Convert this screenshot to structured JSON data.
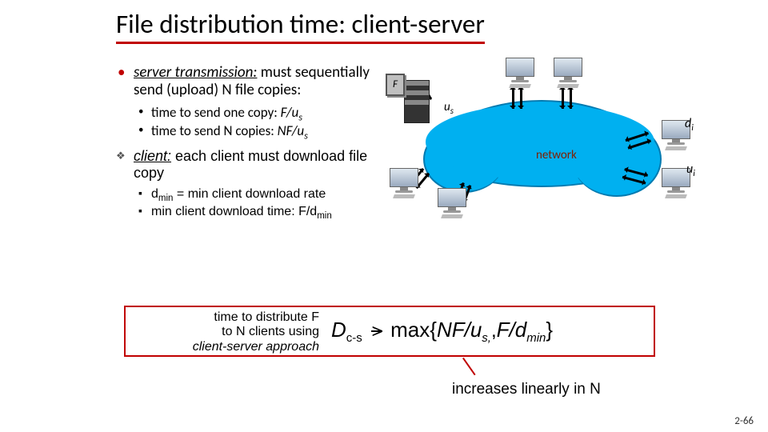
{
  "title": "File distribution time: client-server",
  "server_tx": {
    "heading_ital": "server transmission:",
    "heading_rest": " must sequentially send (upload) N file copies:",
    "sub1_a": "time to send one copy: ",
    "sub1_b": "F/u",
    "sub1_s": "s",
    "sub2_a": "time to send N copies: ",
    "sub2_b": "NF/u",
    "sub2_s": "s"
  },
  "client": {
    "heading_ital": "client:",
    "heading_rest": " each client must download file copy",
    "sub1_a": "d",
    "sub1_s": "min",
    "sub1_b": " = min client download rate",
    "sub2_a": "min client download time: F/d",
    "sub2_s": "min"
  },
  "diagram": {
    "F": "F",
    "us": "u",
    "us_s": "s",
    "di": "d",
    "di_s": "i",
    "ui": "u",
    "ui_s": "i",
    "network": "network"
  },
  "box": {
    "left1": "time to  distribute F",
    "left2": "to N clients using",
    "left3": "client-server approach",
    "D": "D",
    "D_sub": "c-s",
    "ge": ">",
    "max": "max{",
    "t1a": "NF/u",
    "t1s": "s,",
    "comma": ",",
    "t2a": "F/d",
    "t2s": "min",
    "close": "}"
  },
  "increases": "increases linearly in N",
  "page": "2-66"
}
